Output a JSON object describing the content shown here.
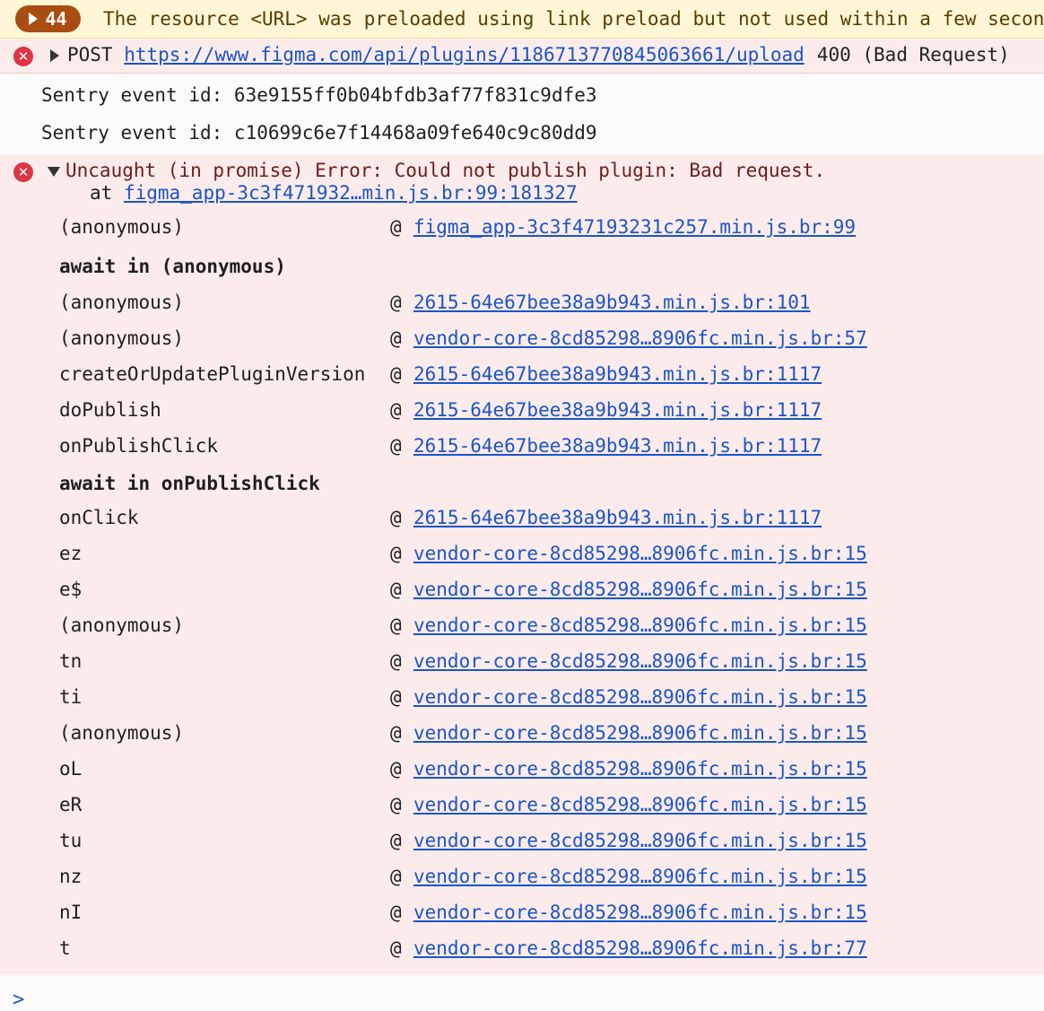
{
  "warning": {
    "count": "44",
    "message": "The resource <URL> was preloaded using link preload but not used within a few seconds"
  },
  "network_error": {
    "method": "POST",
    "url": "https://www.figma.com/api/plugins/1186713770845063661/upload",
    "status": "400 (Bad Request)"
  },
  "sentry": [
    "Sentry event id: 63e9155ff0b04bfdb3af77f831c9dfe3",
    "Sentry event id: c10699c6e7f14468a09fe640c9c80dd9"
  ],
  "uncaught": {
    "title": "Uncaught (in promise) Error: Could not publish plugin: Bad request.",
    "at_prefix": "at ",
    "at_link": "figma_app-3c3f471932…min.js.br:99:181327",
    "at_symbol": "@",
    "frames": [
      {
        "fn": "(anonymous)",
        "loc": "figma_app-3c3f47193231c257.min.js.br:99"
      },
      {
        "await": "await in (anonymous)"
      },
      {
        "fn": "(anonymous)",
        "loc": "2615-64e67bee38a9b943.min.js.br:101"
      },
      {
        "fn": "(anonymous)",
        "loc": "vendor-core-8cd85298…8906fc.min.js.br:57"
      },
      {
        "fn": "createOrUpdatePluginVersion",
        "loc": "2615-64e67bee38a9b943.min.js.br:1117"
      },
      {
        "fn": "doPublish",
        "loc": "2615-64e67bee38a9b943.min.js.br:1117"
      },
      {
        "fn": "onPublishClick",
        "loc": "2615-64e67bee38a9b943.min.js.br:1117"
      },
      {
        "await": "await in onPublishClick"
      },
      {
        "fn": "onClick",
        "loc": "2615-64e67bee38a9b943.min.js.br:1117"
      },
      {
        "fn": "ez",
        "loc": "vendor-core-8cd85298…8906fc.min.js.br:15"
      },
      {
        "fn": "e$",
        "loc": "vendor-core-8cd85298…8906fc.min.js.br:15"
      },
      {
        "fn": "(anonymous)",
        "loc": "vendor-core-8cd85298…8906fc.min.js.br:15"
      },
      {
        "fn": "tn",
        "loc": "vendor-core-8cd85298…8906fc.min.js.br:15"
      },
      {
        "fn": "ti",
        "loc": "vendor-core-8cd85298…8906fc.min.js.br:15"
      },
      {
        "fn": "(anonymous)",
        "loc": "vendor-core-8cd85298…8906fc.min.js.br:15"
      },
      {
        "fn": "oL",
        "loc": "vendor-core-8cd85298…8906fc.min.js.br:15"
      },
      {
        "fn": "eR",
        "loc": "vendor-core-8cd85298…8906fc.min.js.br:15"
      },
      {
        "fn": "tu",
        "loc": "vendor-core-8cd85298…8906fc.min.js.br:15"
      },
      {
        "fn": "nz",
        "loc": "vendor-core-8cd85298…8906fc.min.js.br:15"
      },
      {
        "fn": "nI",
        "loc": "vendor-core-8cd85298…8906fc.min.js.br:15"
      },
      {
        "fn": "t",
        "loc": "vendor-core-8cd85298…8906fc.min.js.br:77"
      }
    ]
  },
  "prompt_symbol": ">",
  "error_icon_glyph": "✕"
}
